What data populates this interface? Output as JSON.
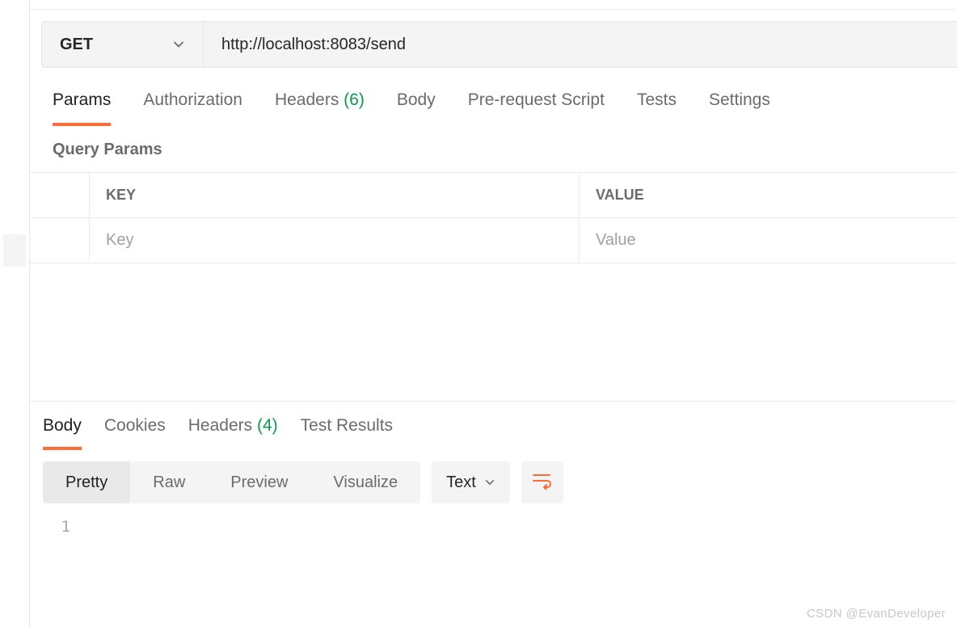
{
  "request": {
    "method": "GET",
    "url": "http://localhost:8083/send"
  },
  "req_tabs": {
    "params": "Params",
    "auth": "Authorization",
    "headers_label": "Headers",
    "headers_count": "(6)",
    "body": "Body",
    "prereq": "Pre-request Script",
    "tests": "Tests",
    "settings": "Settings"
  },
  "query_params": {
    "section_label": "Query Params",
    "header_key": "KEY",
    "header_value": "VALUE",
    "placeholder_key": "Key",
    "placeholder_value": "Value"
  },
  "resp_tabs": {
    "body": "Body",
    "cookies": "Cookies",
    "headers_label": "Headers",
    "headers_count": "(4)",
    "tests": "Test Results"
  },
  "view_modes": {
    "pretty": "Pretty",
    "raw": "Raw",
    "preview": "Preview",
    "visualize": "Visualize"
  },
  "lang_select": "Text",
  "response_body": {
    "line_numbers": [
      "1"
    ],
    "lines": [
      ""
    ]
  },
  "watermark": "CSDN @EvanDeveloper",
  "colors": {
    "accent": "#ff6c37",
    "green": "#0a9b4b"
  }
}
